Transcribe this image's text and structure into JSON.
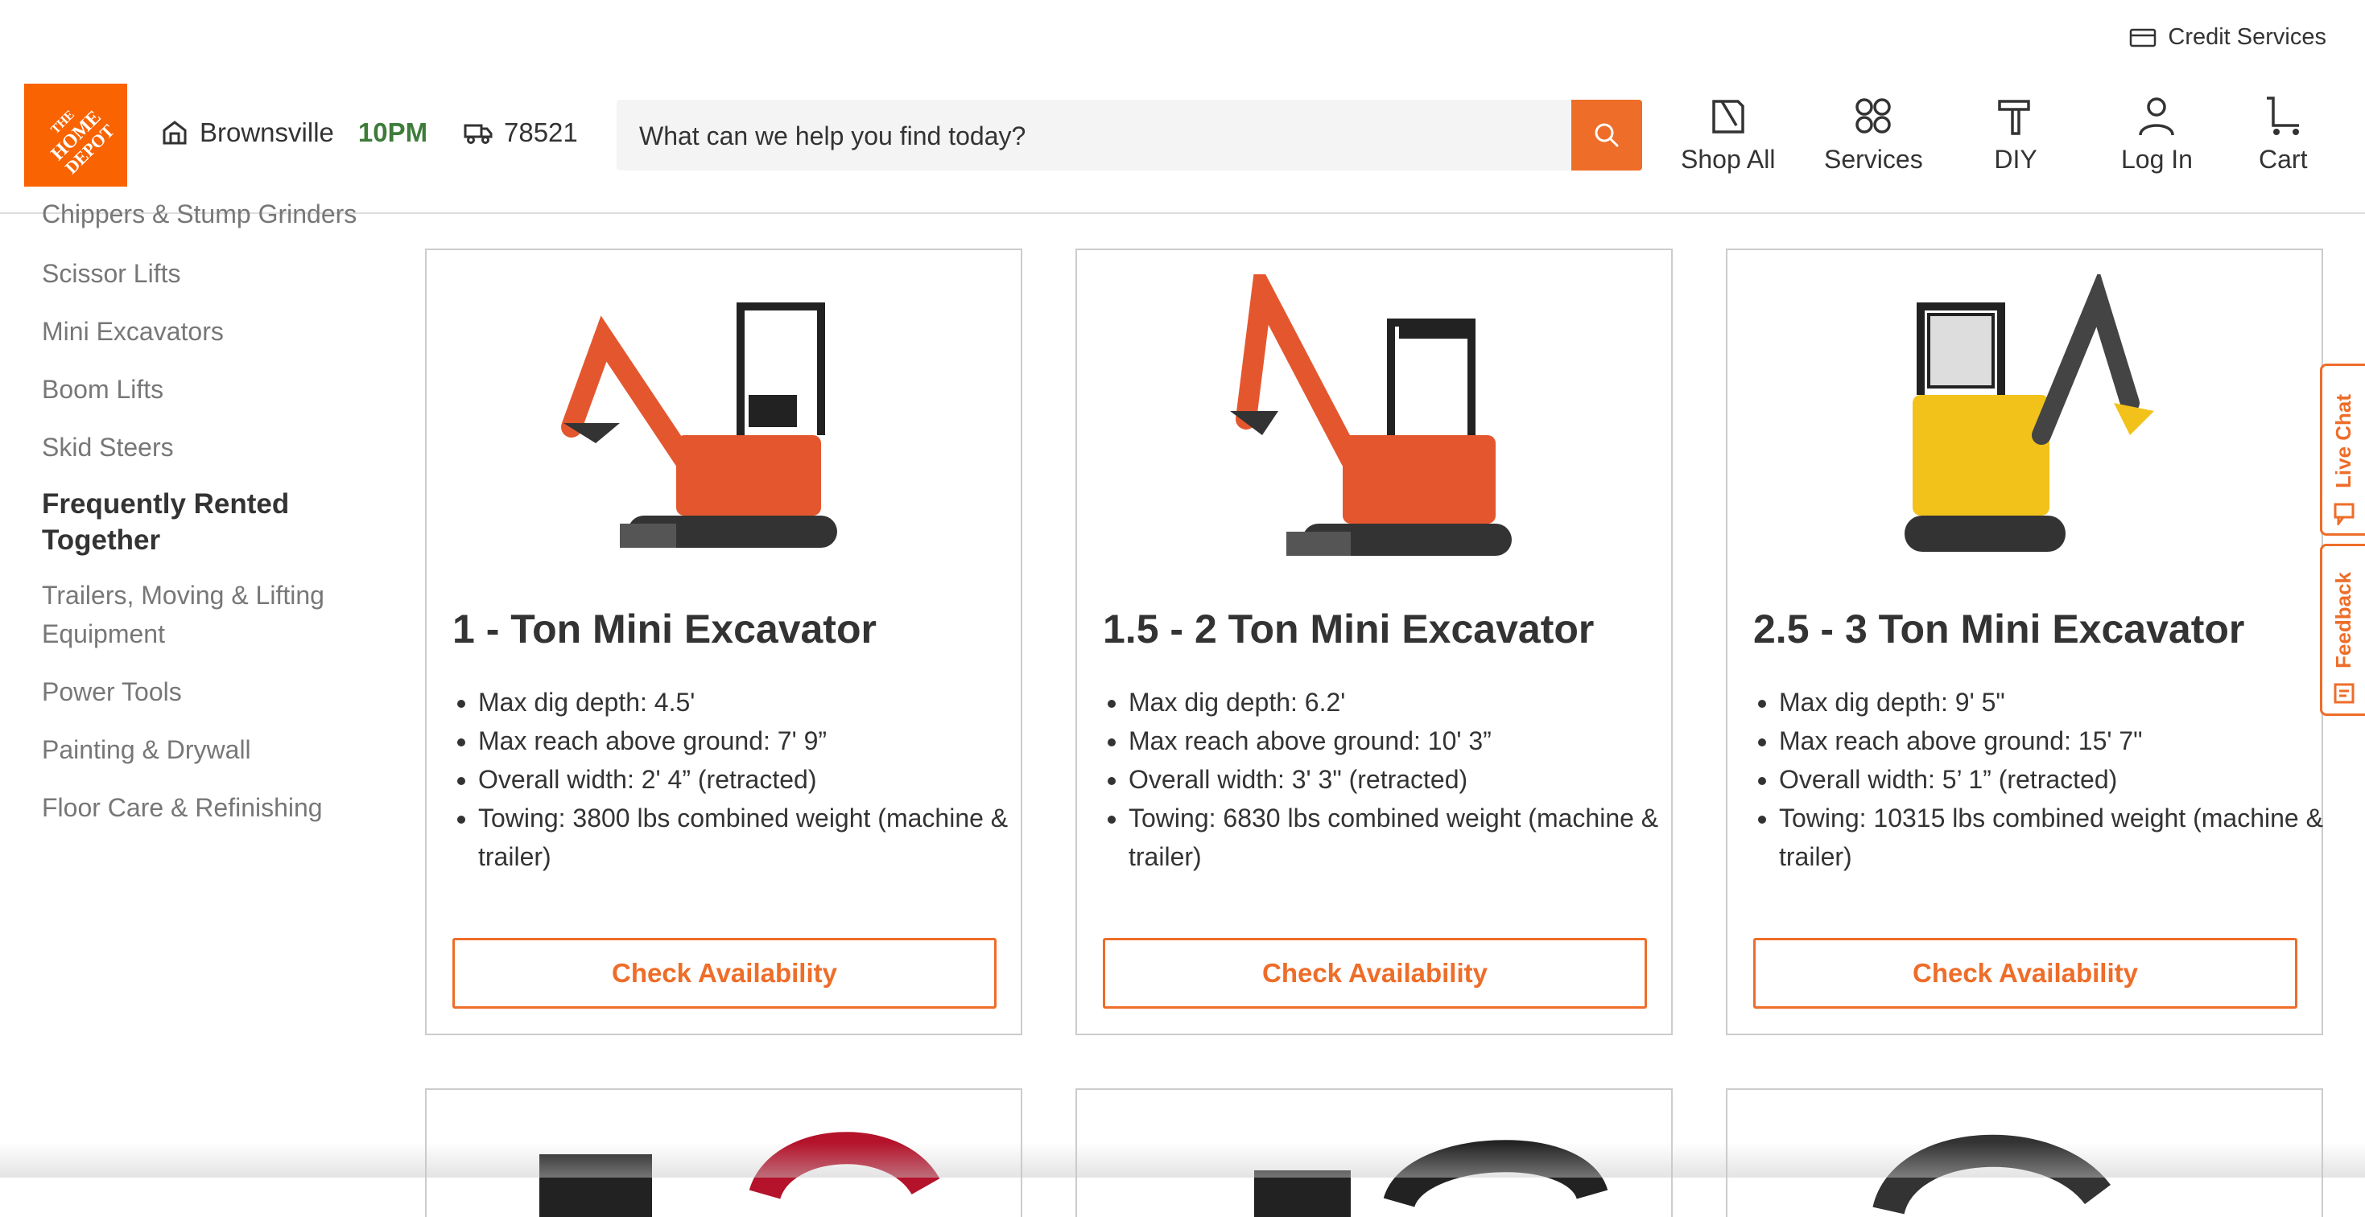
{
  "topbar": {
    "credit_label": "Credit Services"
  },
  "header": {
    "logo_alt": "THE HOME DEPOT",
    "store": {
      "name": "Brownsville",
      "hours": "10PM"
    },
    "zip": "78521",
    "search_placeholder": "What can we help you find today?",
    "nav": [
      {
        "label": "Shop All",
        "icon": "shop-all-icon"
      },
      {
        "label": "Services",
        "icon": "services-icon"
      },
      {
        "label": "DIY",
        "icon": "diy-icon"
      },
      {
        "label": "Log In",
        "icon": "user-icon"
      },
      {
        "label": "Cart",
        "icon": "cart-icon"
      }
    ]
  },
  "sidebar": {
    "clipped_item": "Chippers & Stump Grinders",
    "items": [
      "Scissor Lifts",
      "Mini Excavators",
      "Boom Lifts",
      "Skid Steers"
    ],
    "heading": "Frequently Rented Together",
    "related": [
      "Trailers, Moving & Lifting Equipment",
      "Power Tools",
      "Painting & Drywall",
      "Floor Care & Refinishing"
    ]
  },
  "products": [
    {
      "title": "1 - Ton Mini Excavator",
      "specs": [
        "Max dig depth: 4.5'",
        "Max reach above ground: 7' 9”",
        "Overall width: 2' 4” (retracted)",
        "Towing: 3800 lbs combined weight (machine & trailer)"
      ],
      "cta": "Check Availability",
      "color": "#e4572e"
    },
    {
      "title": "1.5 - 2 Ton Mini Excavator",
      "specs": [
        "Max dig depth: 6.2'",
        "Max reach above ground: 10' 3”",
        "Overall width: 3' 3\" (retracted)",
        "Towing: 6830 lbs combined weight (machine & trailer)"
      ],
      "cta": "Check Availability",
      "color": "#e4572e"
    },
    {
      "title": "2.5 - 3 Ton Mini Excavator",
      "specs": [
        "Max dig depth: 9' 5\"",
        "Max reach above ground: 15' 7\"",
        "Overall width: 5’ 1” (retracted)",
        "Towing: 10315 lbs combined weight (machine & trailer)"
      ],
      "cta": "Check Availability",
      "color": "#f2c21b"
    }
  ],
  "side_tabs": {
    "live_chat": "Live Chat",
    "feedback": "Feedback"
  },
  "colors": {
    "brand": "#ee6d29",
    "hours_green": "#3e7c39"
  }
}
